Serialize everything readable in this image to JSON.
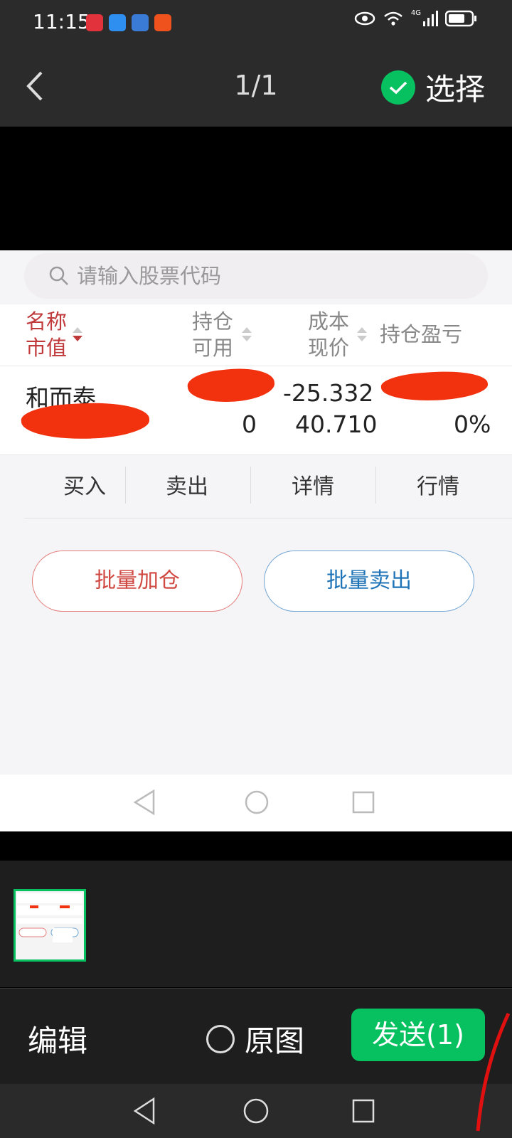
{
  "status_bar": {
    "time": "11:15",
    "network": "4G"
  },
  "header": {
    "page_counter": "1/1",
    "select_label": "选择"
  },
  "preview": {
    "search": {
      "placeholder": "请输入股票代码"
    },
    "table": {
      "headers": {
        "col1_line1": "名称",
        "col1_line2": "市值",
        "col2_line1": "持仓",
        "col2_line2": "可用",
        "col3_line1": "成本",
        "col3_line2": "现价",
        "col4": "持仓盈亏"
      },
      "row": {
        "name": "和而泰",
        "available": "0",
        "cost": "-25.332",
        "price": "40.710",
        "pnl_percent": "0%"
      }
    },
    "actions": [
      "买入",
      "卖出",
      "详情",
      "行情"
    ],
    "batch_add": "批量加仓",
    "batch_sell": "批量卖出"
  },
  "bottom_bar": {
    "edit_label": "编辑",
    "original_label": "原图",
    "send_label": "发送(1)"
  },
  "colors": {
    "accent_green": "#07c160",
    "header_red": "#c0393b",
    "redaction_red": "#f2320e"
  }
}
